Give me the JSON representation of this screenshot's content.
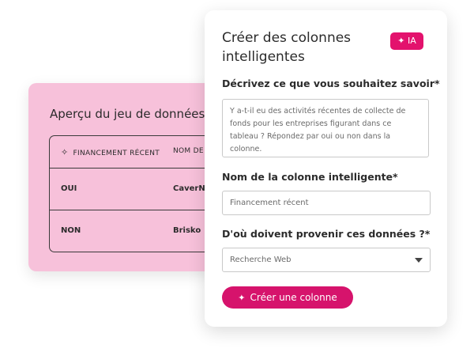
{
  "preview": {
    "title": "Aperçu du jeu de données",
    "columns": [
      {
        "icon": "sparkle-icon",
        "label": "FINANCEMENT RÉCENT"
      },
      {
        "label": "NOM DE"
      }
    ],
    "rows": [
      [
        "OUI",
        "CaverNe"
      ],
      [
        "NON",
        "Brisko"
      ]
    ]
  },
  "modal": {
    "title": "Créer des colonnes intelligentes",
    "badge": {
      "icon": "sparkle-icon",
      "label": "IA"
    },
    "question_label": "Décrivez ce que vous souhaitez savoir*",
    "question_value": "Y a-t-il eu des activités récentes de collecte de fonds pour les entreprises figurant dans ce tableau ? Répondez par oui ou non dans la colonne.",
    "name_label": "Nom de la colonne intelligente*",
    "name_value": "Financement récent",
    "source_label": "D'où doivent provenir ces données ?*",
    "source_value": "Recherche Web",
    "create_button": "Créer une colonne"
  },
  "colors": {
    "accent": "#e3126d",
    "preview_background": "#f7c1da"
  }
}
